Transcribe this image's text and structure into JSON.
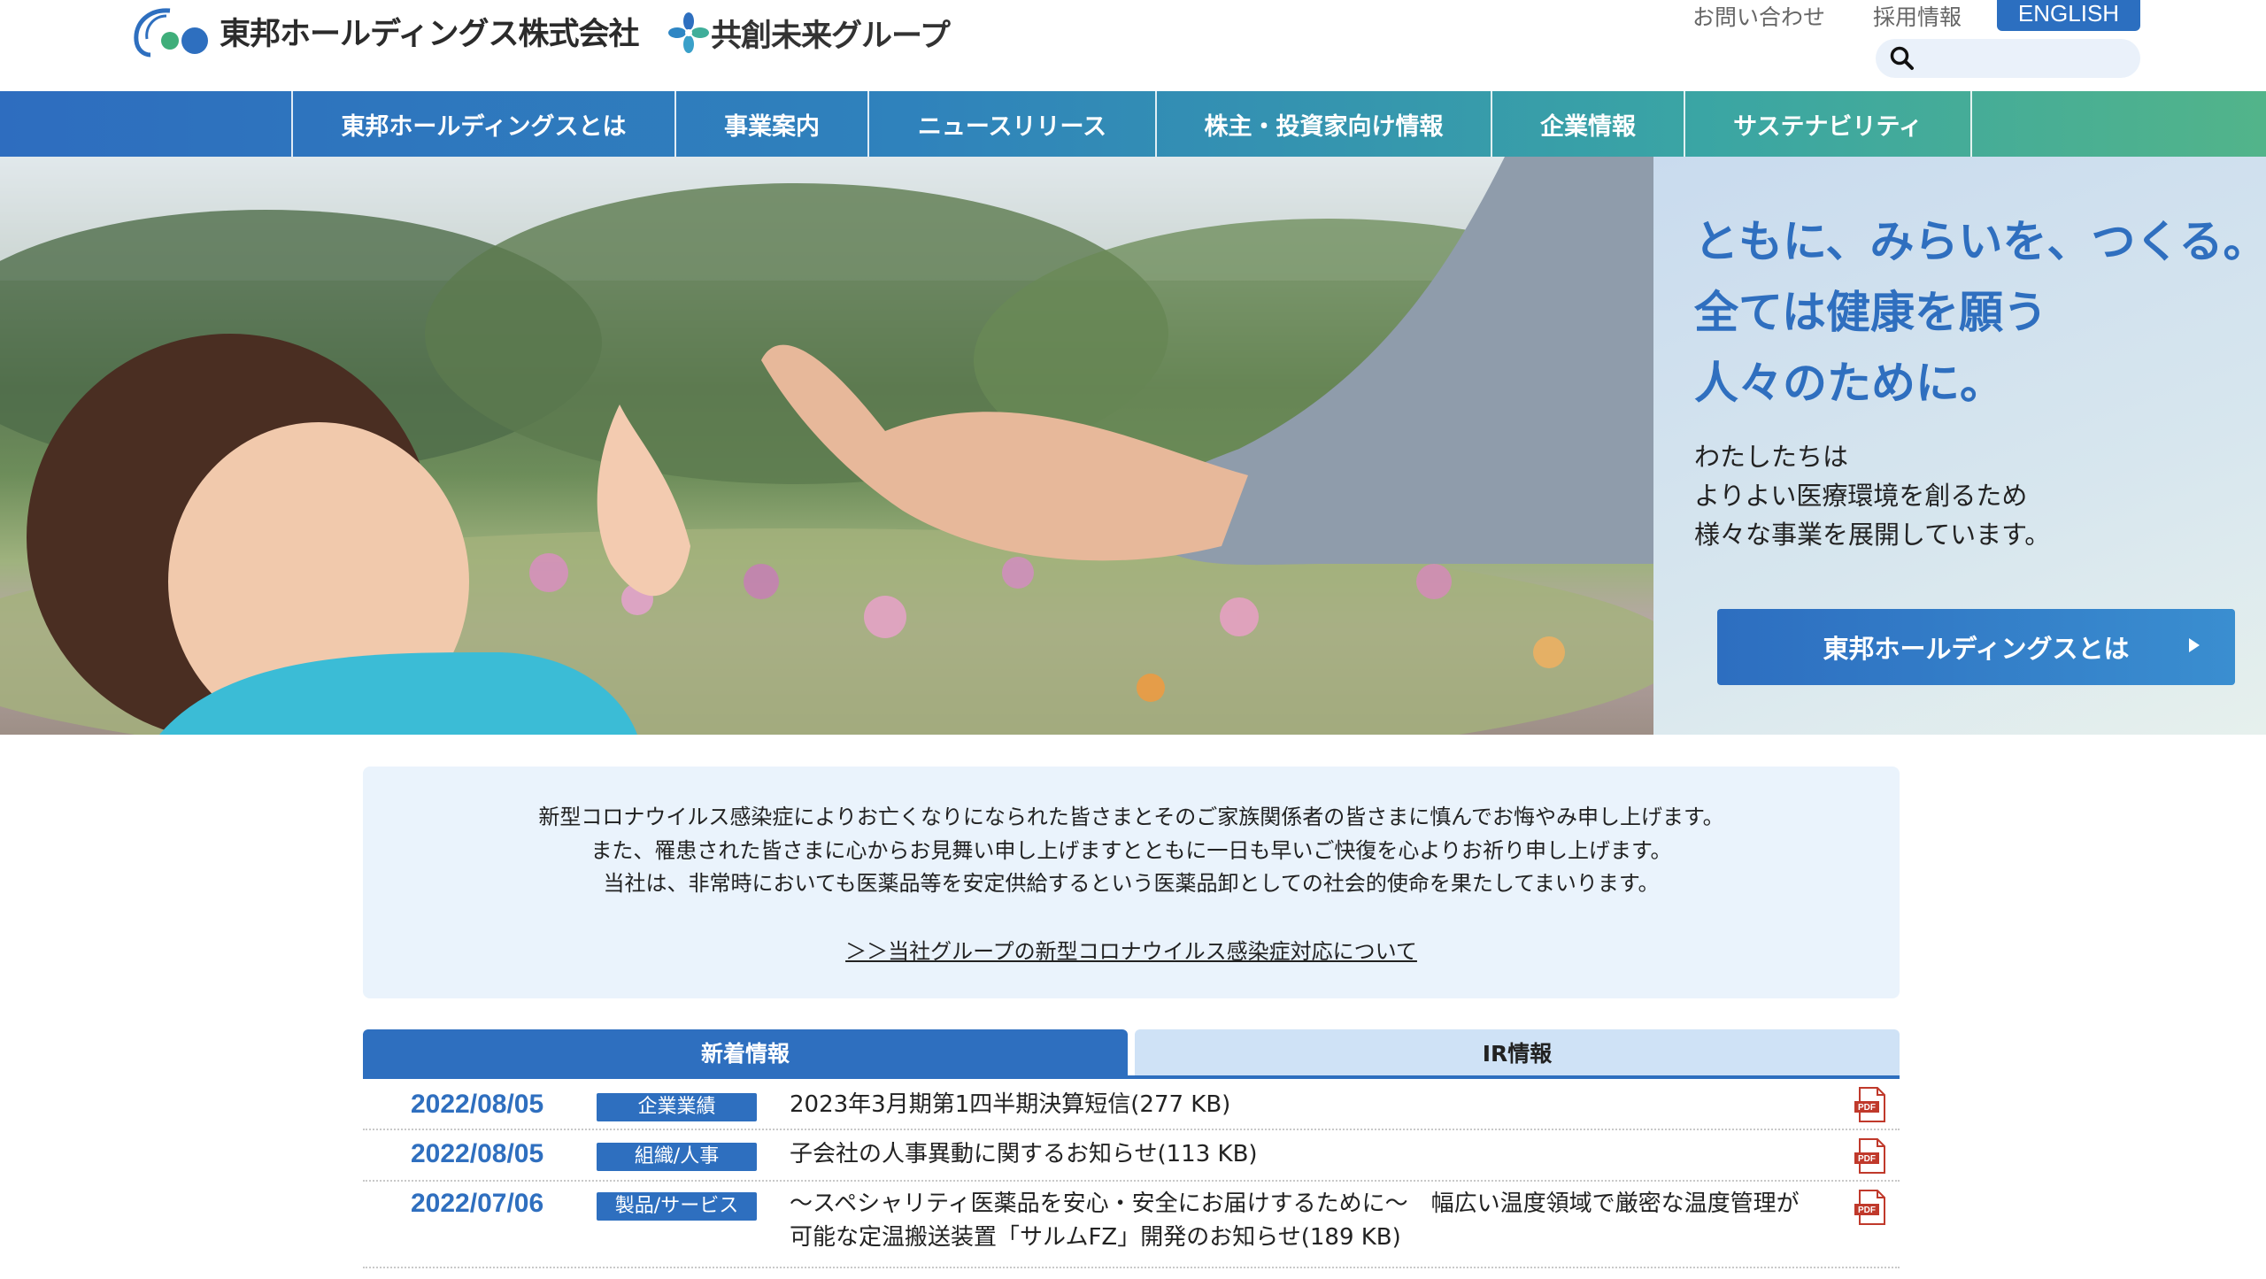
{
  "header": {
    "company_name": "東邦ホールディングス株式会社",
    "group_name": "共創未来グループ",
    "util_links": [
      "お問い合わせ",
      "採用情報"
    ],
    "english_label": "ENGLISH",
    "search_placeholder": ""
  },
  "nav": {
    "items": [
      {
        "label": "東邦ホールディングスとは"
      },
      {
        "label": "事業案内"
      },
      {
        "label": "ニュースリリース"
      },
      {
        "label": "株主・投資家向け情報"
      },
      {
        "label": "企業情報"
      },
      {
        "label": "サステナビリティ"
      }
    ]
  },
  "hero": {
    "catch_lines": [
      "ともに、みらいを、つくる。",
      "全ては健康を願う",
      "人々のために。"
    ],
    "desc_lines": [
      "わたしたちは",
      "よりよい医療環境を創るため",
      "様々な事業を展開しています。"
    ],
    "button_label": "東邦ホールディングスとは"
  },
  "notice": {
    "lines": [
      "新型コロナウイルス感染症によりお亡くなりになられた皆さまとそのご家族関係者の皆さまに慎んでお悔やみ申し上げます。",
      "また、罹患された皆さまに心からお見舞い申し上げますとともに一日も早いご快復を心よりお祈り申し上げます。",
      "当社は、非常時においても医薬品等を安定供給するという医薬品卸としての社会的使命を果たしてまいります。"
    ],
    "link_label": "＞＞当社グループの新型コロナウイルス感染症対応について"
  },
  "tabs": {
    "active": "新着情報",
    "inactive": "IR情報"
  },
  "news": [
    {
      "date": "2022/08/05",
      "tag": "企業業績",
      "title": "2023年3月期第1四半期決算短信(277 KB)"
    },
    {
      "date": "2022/08/05",
      "tag": "組織/人事",
      "title": "子会社の人事異動に関するお知らせ(113 KB)"
    },
    {
      "date": "2022/07/06",
      "tag": "製品/サービス",
      "title": "〜スペシャリティ医薬品を安心・安全にお届けするために〜　幅広い温度領域で厳密な温度管理が可能な定温搬送装置「サルムFZ」開発のお知らせ(189 KB)"
    }
  ],
  "pdf_label": "PDF",
  "colors": {
    "brand_blue": "#2e6fbf",
    "nav_green": "#52b48a",
    "notice_bg": "#eaf3fc"
  }
}
